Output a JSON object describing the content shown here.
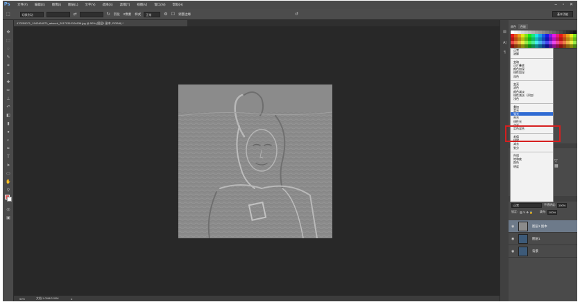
{
  "app": {
    "logo": "Ps",
    "menu": [
      "文件(F)",
      "编辑(E)",
      "图像(I)",
      "图层(L)",
      "文字(Y)",
      "选择(S)",
      "滤镜(T)",
      "视图(V)",
      "窗口(W)",
      "帮助(H)"
    ],
    "window_controls": [
      "–",
      "▫",
      "✕"
    ]
  },
  "options_bar": {
    "preset": "切换到动",
    "feather_label": "羽化",
    "feather_value": "0像素",
    "style_label": "样式",
    "style_value": "正常",
    "checkbox_label": "调整边缘",
    "workspace": "基本功能"
  },
  "document": {
    "tab_title": "470259071_1942464070_artwork_20170310104636.jpg @ 50% (图层1 副本, RGB/8) *"
  },
  "status": {
    "zoom": "50%",
    "doc_info": "文档:1.00M/3.00M"
  },
  "panels": {
    "swatch_tabs": [
      "颜色",
      "色板"
    ],
    "layers": {
      "blend_mode": "正常",
      "opacity_label": "不透明度:",
      "opacity_value": "100%",
      "lock_label": "锁定:",
      "fill_label": "填充:",
      "fill_value": "100%",
      "items": [
        {
          "name": "图层1 副本"
        },
        {
          "name": "图层1"
        },
        {
          "name": "背景"
        }
      ]
    }
  },
  "blend_modes": {
    "groups": [
      [
        "正常",
        "溶解"
      ],
      [
        "变暗",
        "正片叠底",
        "颜色加深",
        "线性加深",
        "深色"
      ],
      [
        "变亮",
        "滤色",
        "颜色减淡",
        "线性减淡（添加）",
        "浅色"
      ],
      [
        "叠加",
        "柔光",
        "强光",
        "亮光",
        "线性光",
        "点光",
        "实色混合"
      ],
      [
        "差值",
        "排除",
        "减去",
        "划分"
      ],
      [
        "色相",
        "饱和度",
        "颜色",
        "明度"
      ]
    ],
    "selected": "强光"
  },
  "colors": {
    "highlight": "#d61f1f",
    "selection": "#2f6bd3",
    "foreground": "#d95b5b",
    "background": "#ffffff"
  }
}
